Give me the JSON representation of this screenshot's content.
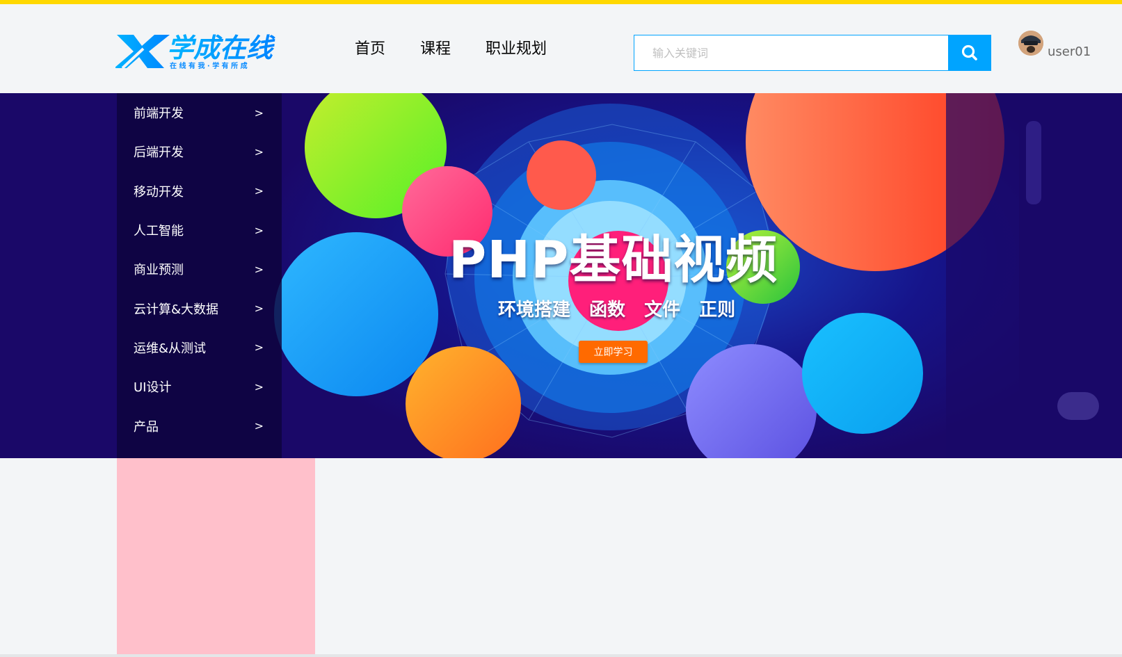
{
  "colors": {
    "top_strip": "#ffd800",
    "accent": "#00a4ff",
    "banner_bg": "#1a0868",
    "banner_button": "#ff6a00",
    "pink_block": "#ffc0cb"
  },
  "header": {
    "logo": {
      "main_text": "学成在线",
      "slogan": "在 线 有 我 · 学 有 所 成"
    },
    "nav": [
      "首页",
      "课程",
      "职业规划"
    ],
    "search": {
      "placeholder": "输入关键词",
      "value": "",
      "button_icon": "search-icon"
    },
    "user": {
      "avatar_icon": "avatar-icon",
      "name": "user01"
    }
  },
  "sidebar": {
    "items": [
      {
        "label": "前端开发",
        "arrow": ">"
      },
      {
        "label": "后端开发",
        "arrow": ">"
      },
      {
        "label": "移动开发",
        "arrow": ">"
      },
      {
        "label": "人工智能",
        "arrow": ">"
      },
      {
        "label": "商业预测",
        "arrow": ">"
      },
      {
        "label": "云计算&大数据",
        "arrow": ">"
      },
      {
        "label": "运维&从测试",
        "arrow": ">"
      },
      {
        "label": "UI设计",
        "arrow": ">"
      },
      {
        "label": "产品",
        "arrow": ">"
      }
    ]
  },
  "banner": {
    "title": "PHP基础视频",
    "subtitle": "环境搭建 函数 文件 正则",
    "button_label": "立即学习"
  }
}
